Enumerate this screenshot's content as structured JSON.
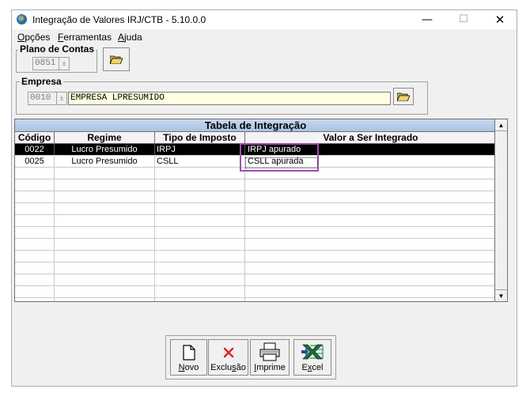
{
  "window": {
    "title": "Integração de Valores IRJ/CTB - 5.10.0.0",
    "controls": {
      "minimize": "—",
      "maximize": "☐",
      "close": "✕"
    }
  },
  "menu": [
    {
      "accel": "O",
      "rest": "pções"
    },
    {
      "accel": "F",
      "rest": "erramentas"
    },
    {
      "accel": "A",
      "rest": "juda"
    }
  ],
  "plano": {
    "label": "Plano de Contas",
    "code": "0851"
  },
  "empresa": {
    "label": "Empresa",
    "code": "0010",
    "name": "EMPRESA LPRESUMIDO"
  },
  "table": {
    "caption": "Tabela de Integração",
    "headers": [
      "Código",
      "Regime",
      "Tipo de Imposto",
      "Valor a Ser Integrado"
    ],
    "rows": [
      {
        "codigo": "0022",
        "regime": "Lucro Presumido",
        "tipo": "IRPJ",
        "valor": "IRPJ apurado"
      },
      {
        "codigo": "0025",
        "regime": "Lucro Presumido",
        "tipo": "CSLL",
        "valor": "CSLL apurada"
      }
    ]
  },
  "toolbar": [
    {
      "accel": "N",
      "rest": "ovo",
      "icon": "new-document-icon"
    },
    {
      "pre": "Exclu",
      "accel": "s",
      "rest": "ão",
      "icon": "delete-x-icon"
    },
    {
      "accel": "I",
      "rest": "mprime",
      "icon": "printer-icon"
    },
    {
      "pre": "E",
      "accel": "x",
      "rest": "cel",
      "icon": "excel-icon"
    }
  ],
  "colors": {
    "accent": "#a050b0",
    "caption_bg": "#b4cbe9",
    "field_bg": "#ffffe0",
    "delete": "#e02020",
    "excel": "#1c6b3a"
  }
}
